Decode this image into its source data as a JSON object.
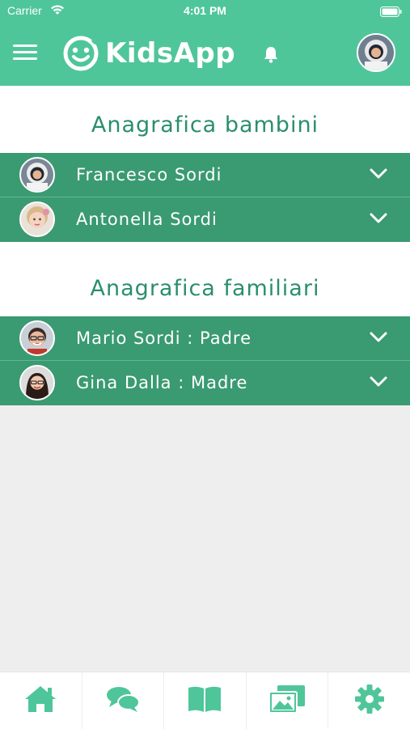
{
  "status_bar": {
    "carrier": "Carrier",
    "time": "4:01 PM"
  },
  "header": {
    "title": "KidsApp"
  },
  "sections": [
    {
      "title": "Anagrafica bambini",
      "items": [
        {
          "name": "Francesco Sordi",
          "avatar": "astronaut-avatar"
        },
        {
          "name": "Antonella Sordi",
          "avatar": "child-girl-avatar"
        }
      ]
    },
    {
      "title": "Anagrafica familiari",
      "items": [
        {
          "name": "Mario Sordi : Padre",
          "avatar": "man-glasses-avatar"
        },
        {
          "name": "Gina Dalla : Madre",
          "avatar": "woman-avatar"
        }
      ]
    }
  ],
  "tab_bar": [
    {
      "icon": "home-icon"
    },
    {
      "icon": "chat-icon"
    },
    {
      "icon": "book-icon"
    },
    {
      "icon": "gallery-icon"
    },
    {
      "icon": "settings-icon"
    }
  ],
  "colors": {
    "primary": "#4fc69a",
    "row": "#3a9a72",
    "title": "#2a8f6a",
    "background": "#eeeeee"
  }
}
